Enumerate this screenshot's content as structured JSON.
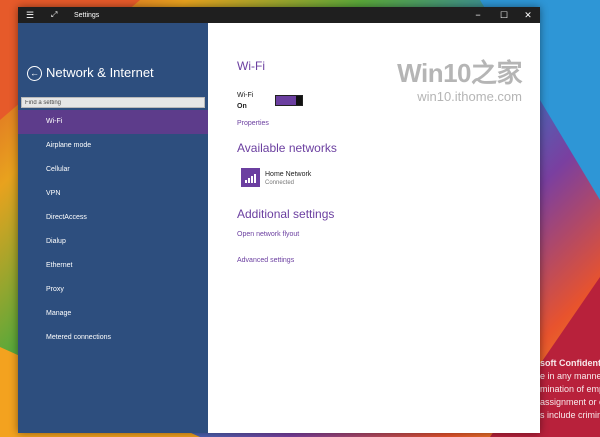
{
  "window": {
    "title": "Settings",
    "controls": {
      "minimize": "−",
      "maximize": "☐",
      "close": "✕"
    }
  },
  "sidebar": {
    "title": "Network & Internet",
    "search": {
      "placeholder": "Find a setting",
      "value": ""
    },
    "items": [
      {
        "label": "Wi-Fi",
        "active": true
      },
      {
        "label": "Airplane mode"
      },
      {
        "label": "Cellular"
      },
      {
        "label": "VPN"
      },
      {
        "label": "DirectAccess"
      },
      {
        "label": "Dialup"
      },
      {
        "label": "Ethernet"
      },
      {
        "label": "Proxy"
      },
      {
        "label": "Manage"
      },
      {
        "label": "Metered connections"
      }
    ]
  },
  "content": {
    "heading": "Wi-Fi",
    "wifi_label": "Wi-Fi",
    "wifi_state": "On",
    "properties_link": "Properties",
    "available_heading": "Available networks",
    "network": {
      "name": "Home Network",
      "status": "Connected"
    },
    "additional_heading": "Additional settings",
    "open_flyout_link": "Open network flyout",
    "advanced_link": "Advanced settings"
  },
  "watermark": {
    "logo": "Win10之家",
    "url": "win10.ithome.com"
  },
  "background_text": [
    "soft Confidentia",
    "e in any manner",
    "mination of emp",
    "assignment or ch",
    "s include crimin"
  ],
  "colors": {
    "accent": "#6b3fa0",
    "sidebar": "#2d4e7e",
    "sidebar_active": "#5d3c8b",
    "titlebar": "#1f1f1f"
  },
  "icons": {
    "back": "back-arrow-icon",
    "hamburger": "hamburger-menu-icon",
    "fullscreen": "fullscreen-icon",
    "network": "wifi-signal-icon"
  }
}
